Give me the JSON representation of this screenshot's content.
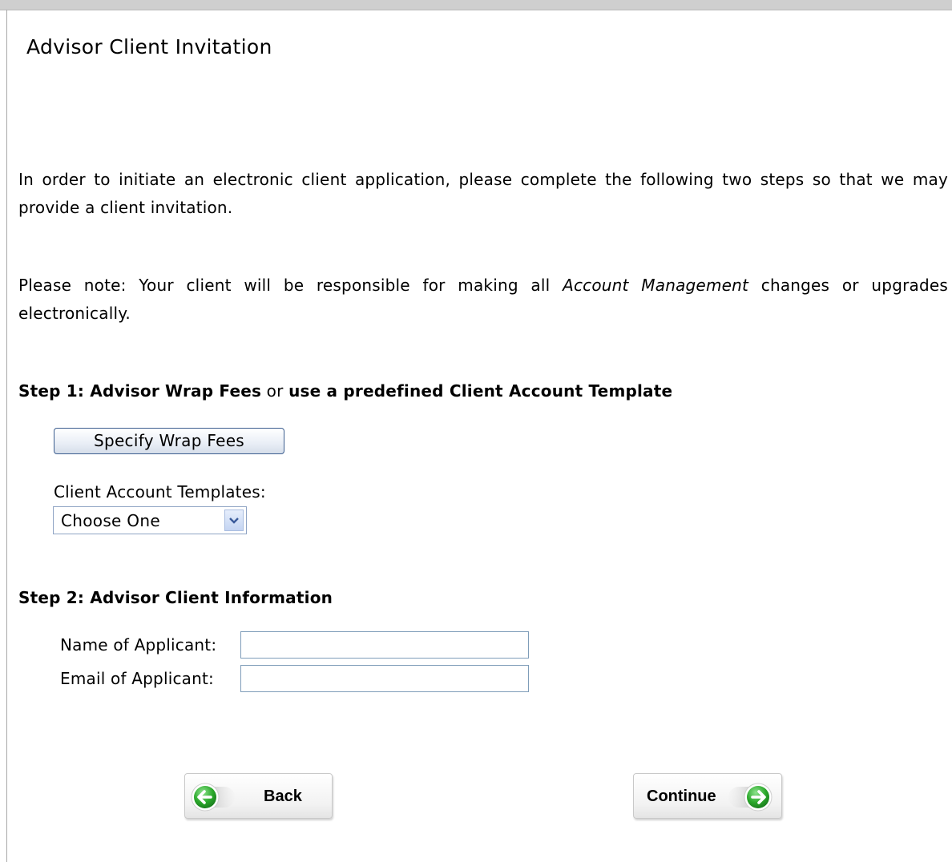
{
  "page": {
    "title": "Advisor Client Invitation"
  },
  "intro": {
    "text": "In order to initiate an electronic client application, please complete the following two steps so that we may provide a client invitation."
  },
  "note": {
    "before": "Please note: Your client will be responsible for making all ",
    "emphasis": "Account Management",
    "after": " changes or upgrades electronically."
  },
  "step1": {
    "label": "Step 1: Advisor Wrap Fees",
    "connector": " or ",
    "label_end": "use a predefined Client Account Template",
    "wrap_button": "Specify Wrap Fees",
    "templates_label": "Client Account Templates:",
    "templates_selected": "Choose One"
  },
  "step2": {
    "label": "Step 2: Advisor Client Information",
    "name_label": "Name of Applicant:",
    "name_value": "",
    "email_label": "Email of Applicant:",
    "email_value": ""
  },
  "nav": {
    "back_label": "Back",
    "back_icon": "arrow-left-circle-icon",
    "continue_label": "Continue",
    "continue_icon": "arrow-right-circle-icon",
    "icon_color": "#2aa82a"
  }
}
